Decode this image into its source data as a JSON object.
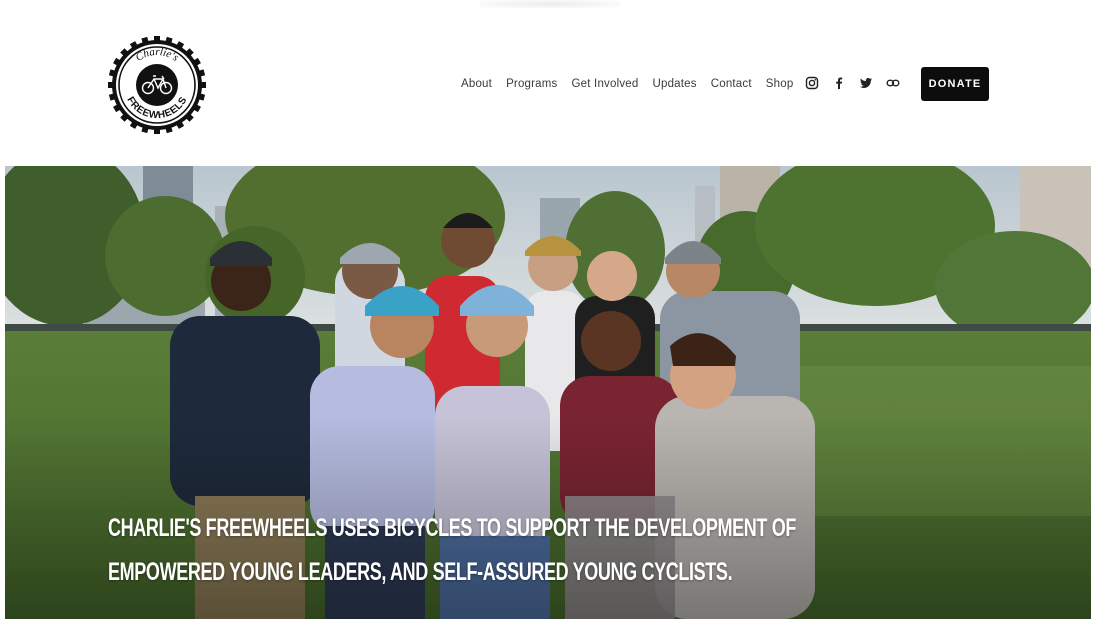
{
  "brand": {
    "logo_top_text": "Charlie's",
    "logo_bottom_text": "FREEWHEELS"
  },
  "nav": {
    "items": [
      {
        "label": "About"
      },
      {
        "label": "Programs"
      },
      {
        "label": "Get Involved"
      },
      {
        "label": "Updates"
      },
      {
        "label": "Contact"
      },
      {
        "label": "Shop"
      }
    ]
  },
  "social": [
    {
      "icon": "instagram-icon"
    },
    {
      "icon": "facebook-icon"
    },
    {
      "icon": "twitter-icon"
    },
    {
      "icon": "link-icon"
    }
  ],
  "donate_label": "DONATE",
  "hero": {
    "headline_line1": "CHARLIE'S FREEWHEELS USES BICYCLES TO SUPPORT THE DEVELOPMENT OF",
    "headline_line2": "EMPOWERED YOUNG LEADERS, AND SELF-ASSURED YOUNG CYCLISTS."
  },
  "colors": {
    "text": "#3a3a3a",
    "button": "#0d0d0d",
    "grass": "#5f7e3f",
    "sky": "#c9d3db"
  }
}
